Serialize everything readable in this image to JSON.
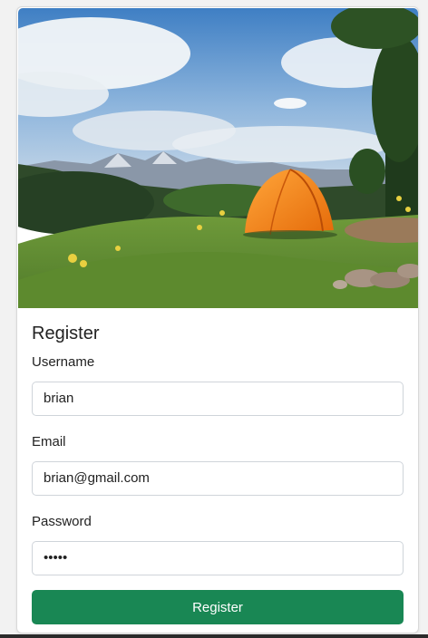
{
  "form": {
    "title": "Register",
    "username_label": "Username",
    "username_value": "brian",
    "email_label": "Email",
    "email_value": "brian@gmail.com",
    "password_label": "Password",
    "password_value": "•••••",
    "submit_label": "Register"
  },
  "colors": {
    "accent": "#198754"
  },
  "hero_image": {
    "icon": "camping-tent-landscape-photo"
  }
}
